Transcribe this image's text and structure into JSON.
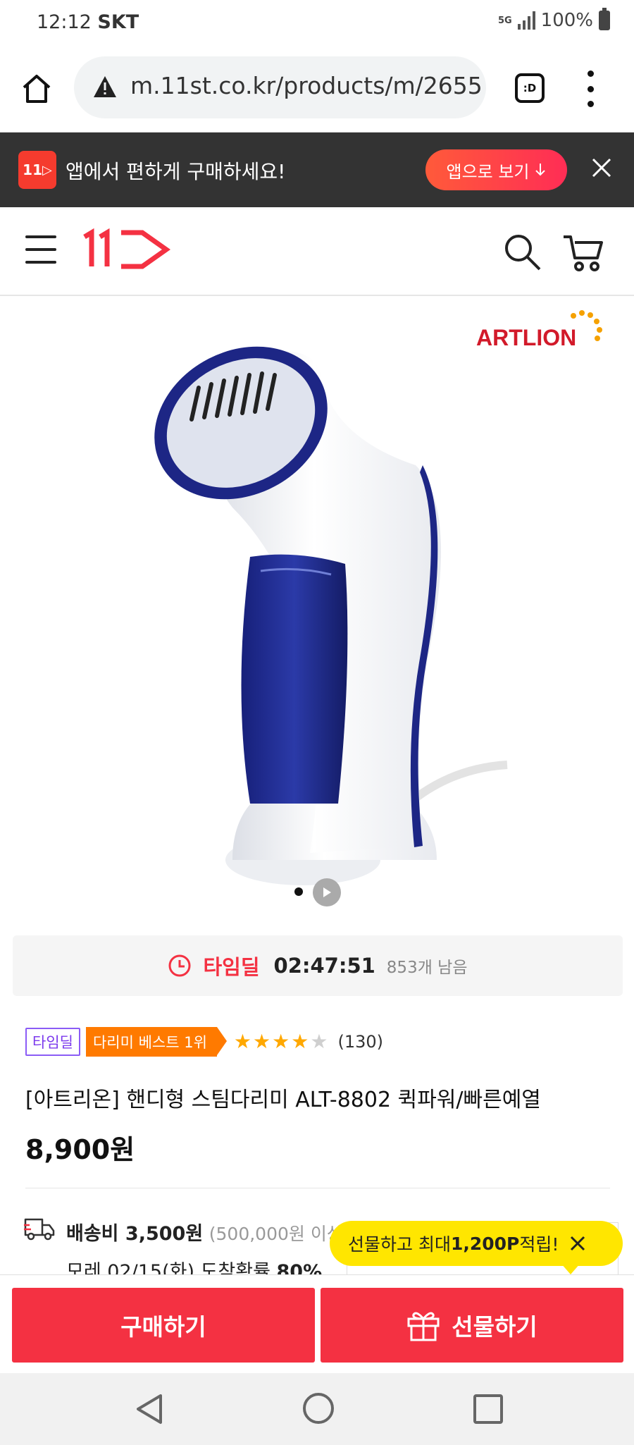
{
  "status_bar": {
    "time": "12:12",
    "carrier": "SKT",
    "network": "5G",
    "battery": "100%"
  },
  "browser": {
    "url": "m.11st.co.kr/products/m/2655",
    "tab_label": ":D"
  },
  "app_banner": {
    "logo_text": "11",
    "message": "앱에서 편하게 구매하세요!",
    "button_label": "앱으로 보기",
    "accent": "#f53b2e"
  },
  "header": {
    "logo_text": "11",
    "logo_color": "#f43142"
  },
  "product": {
    "brand_logo_text": "ARTLION",
    "timedeal": {
      "label": "타임딜",
      "countdown": "02:47:51",
      "remaining": "853개 남음"
    },
    "badges": {
      "timedeal": "타임딜",
      "best": "다리미 베스트 1위"
    },
    "rating": {
      "stars": 4,
      "max": 5,
      "review_count": "(130)"
    },
    "title": "[아트리온] 핸디형 스팀다리미 ALT-8802 퀵파워/빠른예열",
    "price": "8,900원"
  },
  "shipping": {
    "fee": "배송비 3,500원",
    "condition": "(500,000원 이상",
    "arrival_prefix": "모레 02/15(화) 도착확률 ",
    "arrival_prob": "80%"
  },
  "gift_tooltip": {
    "prefix": "선물하고 최대 ",
    "points": "1,200P",
    "suffix": " 적립!"
  },
  "actions": {
    "buy": "구매하기",
    "gift": "선물하기"
  },
  "colors": {
    "primary_red": "#f43142",
    "banner_bg": "#333333",
    "tooltip_yellow": "#ffe600",
    "badge_orange": "#ff7a00",
    "badge_purple": "#8b5cf6",
    "star": "#ffa800"
  }
}
